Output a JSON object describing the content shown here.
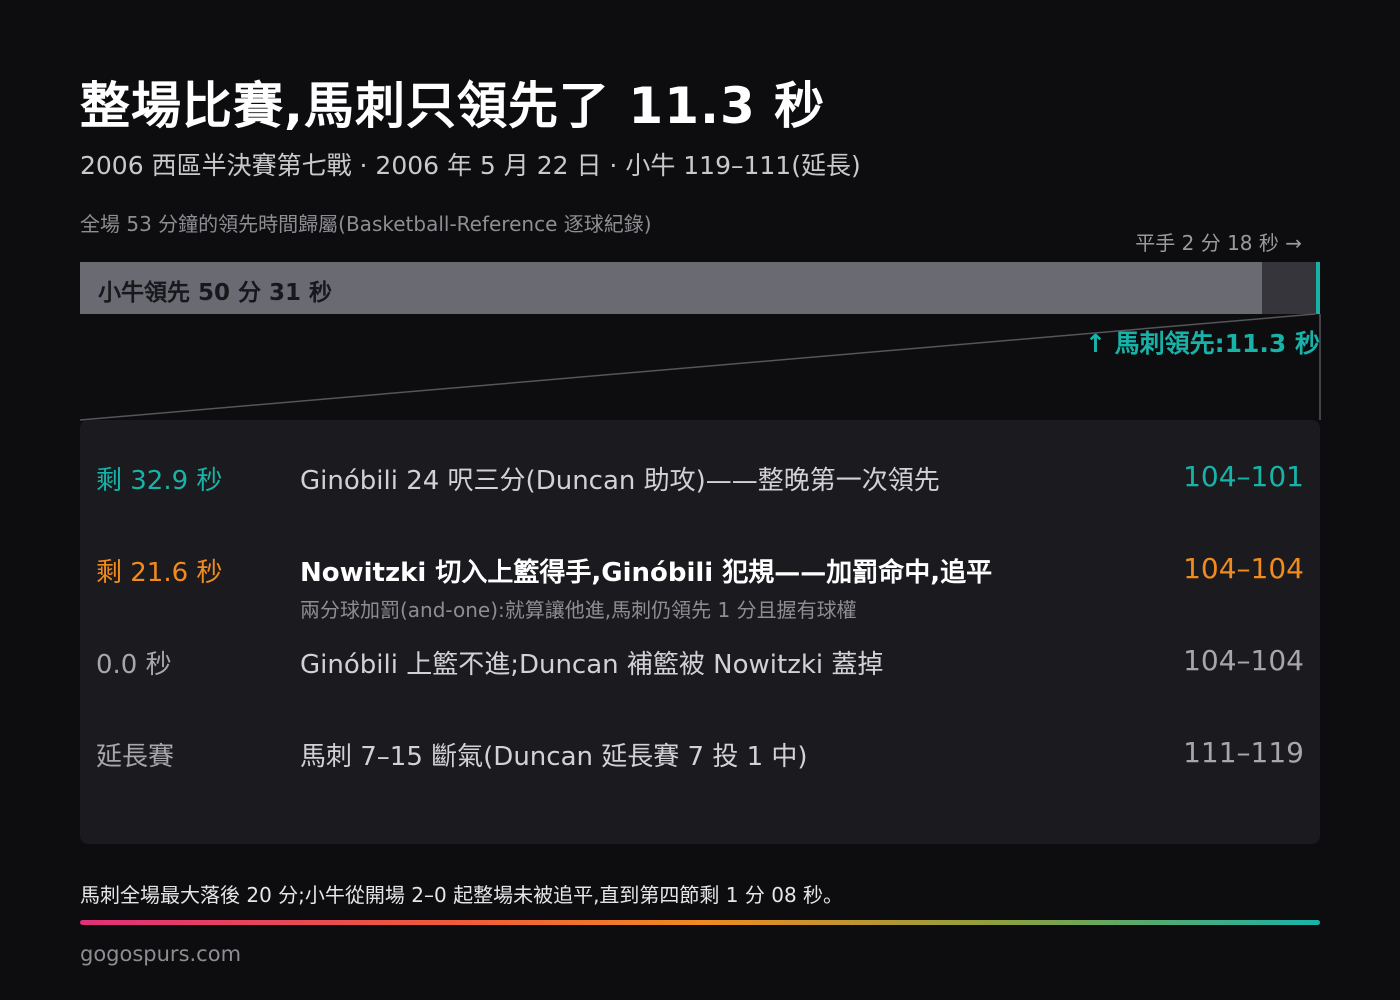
{
  "title": "整場比賽,馬刺只領先了 11.3 秒",
  "subtitle": "2006 西區半決賽第七戰 · 2006 年 5 月 22 日 · 小牛 119–111(延長)",
  "caption": "全場 53 分鐘的領先時間歸屬(Basketball-Reference 逐球紀錄)",
  "chart_data": {
    "type": "bar",
    "orientation": "horizontal",
    "stacked": true,
    "total_seconds": 3180,
    "segments": [
      {
        "name": "小牛領先",
        "seconds": 3031,
        "label": "小牛領先 50 分 31 秒",
        "color": "#6a6b72"
      },
      {
        "name": "平手",
        "seconds": 138,
        "label": "平手 2 分 18 秒 →",
        "color": "#35353b"
      },
      {
        "name": "馬刺領先",
        "seconds": 11.3,
        "label": "↑ 馬刺領先:11.3 秒",
        "color": "#17b3a8"
      }
    ]
  },
  "events": [
    {
      "time": "剩 32.9 秒",
      "desc": "Ginóbili 24 呎三分(Duncan 助攻)——整晚第一次領先",
      "note": "",
      "score": "104–101",
      "time_color": "teal",
      "desc_color": "light",
      "score_color": "teal"
    },
    {
      "time": "剩 21.6 秒",
      "desc": "Nowitzki 切入上籃得手,Ginóbili 犯規——加罰命中,追平",
      "note": "兩分球加罰(and-one):就算讓他進,馬刺仍領先 1 分且握有球權",
      "score": "104–104",
      "time_color": "orange",
      "desc_color": "white",
      "score_color": "orange"
    },
    {
      "time": "0.0 秒",
      "desc": "Ginóbili 上籃不進;Duncan 補籃被 Nowitzki 蓋掉",
      "note": "",
      "score": "104–104",
      "time_color": "grey",
      "desc_color": "light",
      "score_color": "grey"
    },
    {
      "time": "延長賽",
      "desc": "馬刺 7–15 斷氣(Duncan 延長賽 7 投 1 中)",
      "note": "",
      "score": "111–119",
      "time_color": "grey",
      "desc_color": "light",
      "score_color": "grey"
    }
  ],
  "footnote": "馬刺全場最大落後 20 分;小牛從開場 2–0 起整場未被追平,直到第四節剩 1 分 08 秒。",
  "source": "gogospurs.com",
  "colors": {
    "teal": "#17b3a8",
    "orange": "#f28b1e",
    "mavs_bar": "#6a6b72",
    "tie_bar": "#35353b"
  }
}
